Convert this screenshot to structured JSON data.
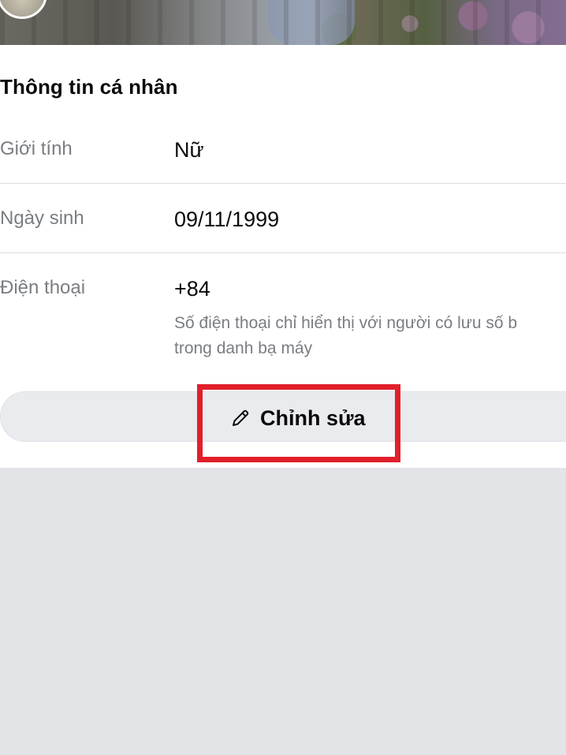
{
  "profile": {
    "section_title": "Thông tin cá nhân",
    "rows": [
      {
        "label": "Giới tính",
        "value": "Nữ"
      },
      {
        "label": "Ngày sinh",
        "value": "09/11/1999"
      },
      {
        "label": "Điện thoại",
        "value": "+84",
        "note_line1": "Số điện thoại chỉ hiển thị với người có lưu số b",
        "note_line2": "trong danh bạ máy"
      }
    ],
    "edit_label": "Chỉnh sửa"
  },
  "icons": {
    "edit": "pencil-icon"
  },
  "colors": {
    "highlight": "#e0202a",
    "background": "#e3e4e8"
  }
}
